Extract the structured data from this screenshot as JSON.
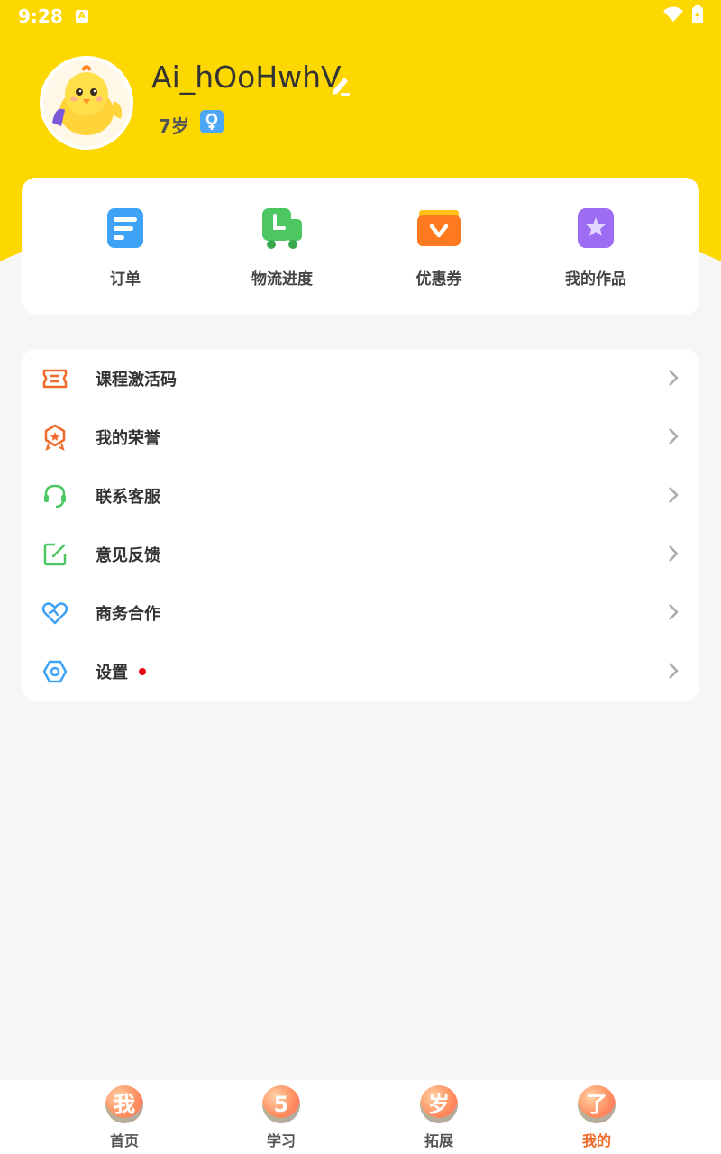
{
  "status_bar": {
    "time": "9:28",
    "a_badge": "A"
  },
  "profile": {
    "username": "Ai_hOoHwhV",
    "age": "7岁"
  },
  "quick_actions": [
    {
      "label": "订单",
      "icon": "order-icon",
      "color": "#3ea2f6"
    },
    {
      "label": "物流进度",
      "icon": "truck-icon",
      "color": "#4cc762"
    },
    {
      "label": "优惠券",
      "icon": "coupon-icon",
      "color": "#ff7a1e"
    },
    {
      "label": "我的作品",
      "icon": "works-icon",
      "color": "#9c6cf3"
    }
  ],
  "menu": [
    {
      "label": "课程激活码",
      "icon": "ticket-icon"
    },
    {
      "label": "我的荣誉",
      "icon": "badge-icon"
    },
    {
      "label": "联系客服",
      "icon": "headset-icon"
    },
    {
      "label": "意见反馈",
      "icon": "feedback-icon"
    },
    {
      "label": "商务合作",
      "icon": "handshake-heart-icon"
    },
    {
      "label": "设置",
      "icon": "settings-icon",
      "has_dot": true
    }
  ],
  "tabbar": [
    {
      "label": "首页",
      "ball": "我"
    },
    {
      "label": "学习",
      "ball": "5"
    },
    {
      "label": "拓展",
      "ball": "岁"
    },
    {
      "label": "我的",
      "ball": "了",
      "active": true
    }
  ],
  "colors": {
    "brand_yellow": "#fdd800",
    "accent_orange": "#f06a2a",
    "red_dot": "#e5001a"
  }
}
